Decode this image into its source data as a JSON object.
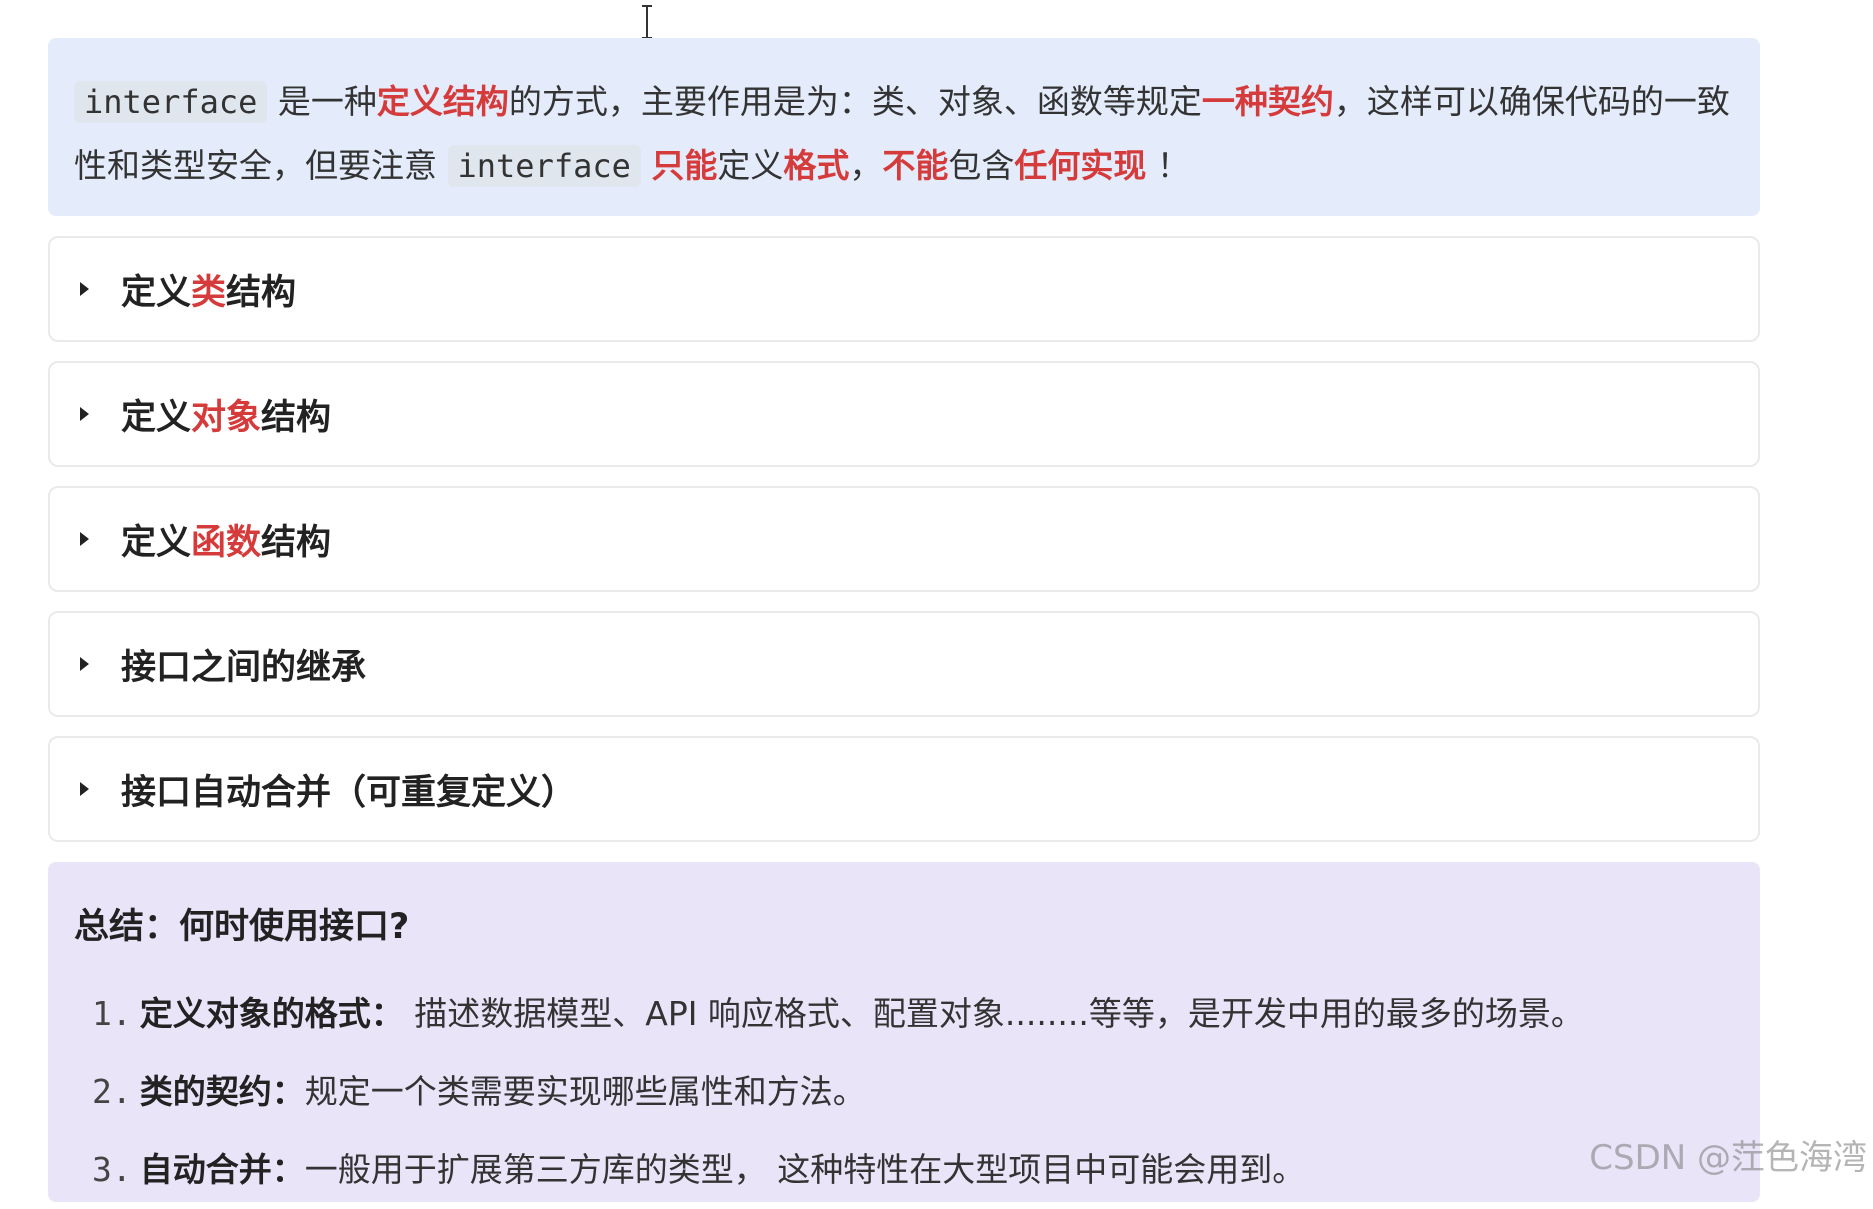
{
  "note": {
    "code_term": "interface",
    "seg1": " 是一种",
    "hl1": "定义结构",
    "seg2": "的方式，主要作用是为：类、对象、函数等规定",
    "hl2": "一种契约",
    "seg3": "，这样可以确保代码的一致性和类型安全，但要注意 ",
    "code_term2": "interface",
    "seg4": " ",
    "hl3": "只能",
    "seg5": "定义",
    "hl4": "格式",
    "seg6": "，",
    "hl5": "不能",
    "seg7": "包含",
    "hl6": "任何实现",
    "seg8": " ！"
  },
  "collapsibles": [
    {
      "pre": "定义",
      "hl": "类",
      "post": "结构"
    },
    {
      "pre": "定义",
      "hl": "对象",
      "post": "结构"
    },
    {
      "pre": "定义",
      "hl": "函数",
      "post": "结构"
    },
    {
      "pre": "接口之间的继承",
      "hl": "",
      "post": ""
    },
    {
      "pre": "接口自动合并（可重复定义）",
      "hl": "",
      "post": ""
    }
  ],
  "summary": {
    "title": "总结：何时使用接口?",
    "items": [
      {
        "num": "1.",
        "key": "定义对象的格式：",
        "text": " 描述数据模型、API 响应格式、配置对象........等等，是开发中用的最多的场景。"
      },
      {
        "num": "2.",
        "key": "类的契约：",
        "text": "规定一个类需要实现哪些属性和方法。"
      },
      {
        "num": "3.",
        "key": "自动合并：",
        "text": "一般用于扩展第三方库的类型， 这种特性在大型项目中可能会用到。"
      }
    ]
  },
  "watermark": "CSDN @茳色海湾",
  "colors": {
    "highlight_red": "#d63b3b",
    "note_bg": "#e4ecfb",
    "summary_bg": "#eae4f8"
  }
}
